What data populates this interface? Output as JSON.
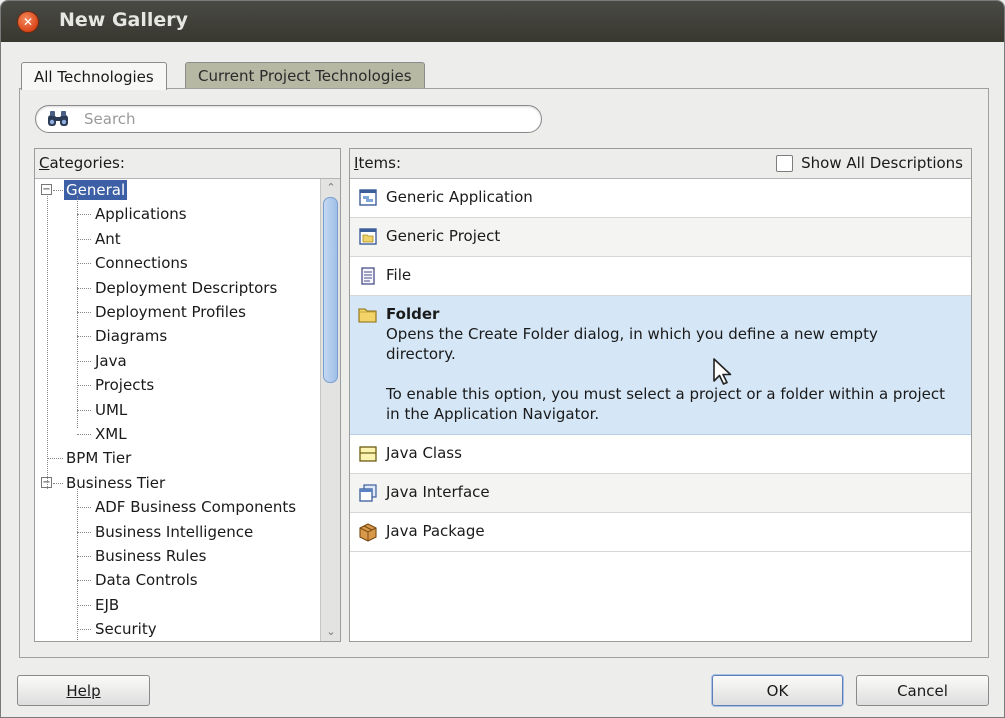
{
  "window": {
    "title": "New Gallery"
  },
  "tabs": [
    {
      "label": "All Technologies",
      "active": true
    },
    {
      "label": "Current Project Technologies",
      "active": false
    }
  ],
  "search": {
    "placeholder": "Search",
    "value": ""
  },
  "categories": {
    "header": "Categories:",
    "tree": [
      {
        "label": "General",
        "expanded": true,
        "selected": true,
        "level": 0
      },
      {
        "label": "Applications",
        "level": 1
      },
      {
        "label": "Ant",
        "level": 1
      },
      {
        "label": "Connections",
        "level": 1
      },
      {
        "label": "Deployment Descriptors",
        "level": 1
      },
      {
        "label": "Deployment Profiles",
        "level": 1
      },
      {
        "label": "Diagrams",
        "level": 1
      },
      {
        "label": "Java",
        "level": 1
      },
      {
        "label": "Projects",
        "level": 1
      },
      {
        "label": "UML",
        "level": 1
      },
      {
        "label": "XML",
        "level": 1
      },
      {
        "label": "BPM Tier",
        "level": 0
      },
      {
        "label": "Business Tier",
        "expanded": true,
        "level": 0
      },
      {
        "label": "ADF Business Components",
        "level": 1
      },
      {
        "label": "Business Intelligence",
        "level": 1
      },
      {
        "label": "Business Rules",
        "level": 1
      },
      {
        "label": "Data Controls",
        "level": 1
      },
      {
        "label": "EJB",
        "level": 1
      },
      {
        "label": "Security",
        "level": 1
      }
    ]
  },
  "items": {
    "header": "Items:",
    "show_all_label": "Show All Descriptions",
    "show_all_checked": false,
    "list": [
      {
        "title": "Generic Application",
        "icon": "application-icon"
      },
      {
        "title": "Generic Project",
        "icon": "project-icon"
      },
      {
        "title": "File",
        "icon": "file-icon"
      },
      {
        "title": "Folder",
        "icon": "folder-icon",
        "selected": true,
        "desc1": "Opens the Create Folder dialog, in which you define a new empty directory.",
        "desc2": "To enable this option, you must select a project or a folder within a project in the Application Navigator."
      },
      {
        "title": "Java Class",
        "icon": "java-class-icon"
      },
      {
        "title": "Java Interface",
        "icon": "java-interface-icon"
      },
      {
        "title": "Java Package",
        "icon": "java-package-icon"
      }
    ]
  },
  "buttons": {
    "help": "Help",
    "ok": "OK",
    "cancel": "Cancel"
  }
}
